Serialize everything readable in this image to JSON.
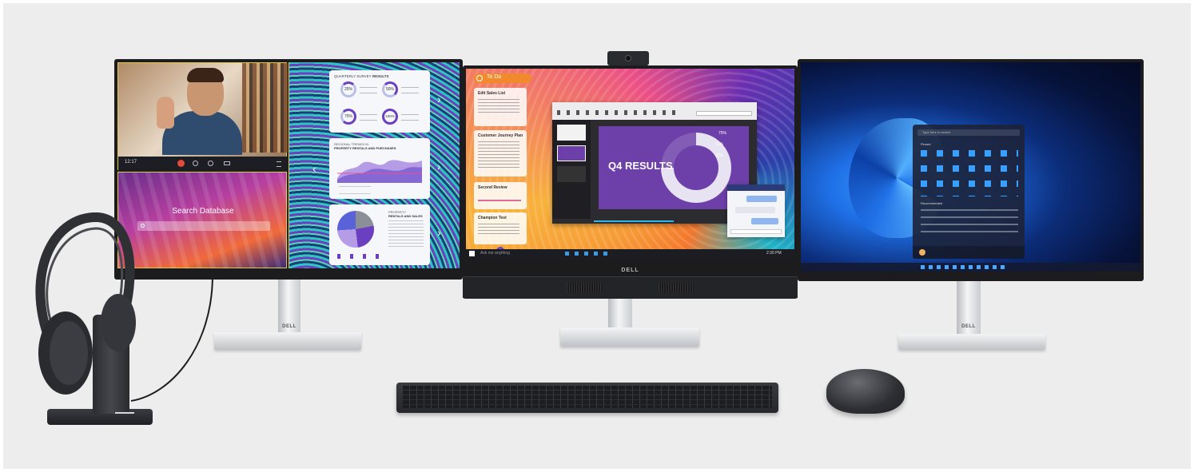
{
  "left_monitor": {
    "video_call": {
      "time": "12:17"
    },
    "database": {
      "search_label": "Search Database"
    },
    "results_panel": {
      "title_prefix": "QUARTERLY SURVEY",
      "title_bold": "RESULTS",
      "rings": [
        "25%",
        "50%",
        "75%",
        "100%"
      ],
      "trend_title_line1": "REGIONAL TRENDS IN",
      "trend_title_line2": "PROPERTY RENTALS AND PURCHASES",
      "pie_title_line1": "PROPERTY",
      "pie_title_line2": "RENTALS AND SALES"
    }
  },
  "center_monitor": {
    "todo": {
      "header": "To Do",
      "cards": [
        "Edit Sales List",
        "Customer Journey Plan",
        "Second Review",
        "Champion Test"
      ]
    },
    "slide": {
      "title": "Q4 RESULTS",
      "labels": [
        "75%",
        "51%",
        "32%"
      ]
    },
    "taskbar": {
      "search_placeholder": "Ask me anything",
      "time": "2:30 PM"
    },
    "brand": "DELL"
  },
  "right_monitor": {
    "start_menu": {
      "search_placeholder": "Type here to search",
      "pinned_label": "Pinned",
      "recommended_label": "Recommended"
    }
  },
  "stand_brand": "DELL",
  "colors": {
    "background": "#ededed",
    "bezel": "#1c1c1e",
    "win11_blue": "#1f6fe6",
    "todo_orange": "#f08a2c",
    "slide_purple": "#6d3fa8"
  }
}
